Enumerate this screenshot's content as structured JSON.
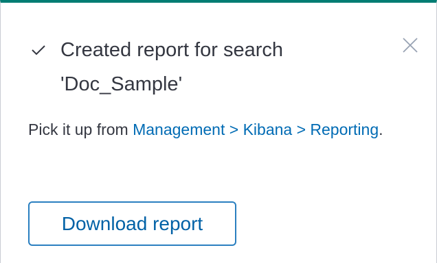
{
  "toast": {
    "title": "Created report for search 'Doc_Sample'",
    "status_icon": "check-icon",
    "close_icon": "close-icon",
    "accent_color": "#017d73",
    "body_prefix": "Pick it up from ",
    "body_link": "Management > Kibana > Reporting",
    "body_suffix": ".",
    "link_color": "#006bb4",
    "download_label": "Download report"
  }
}
